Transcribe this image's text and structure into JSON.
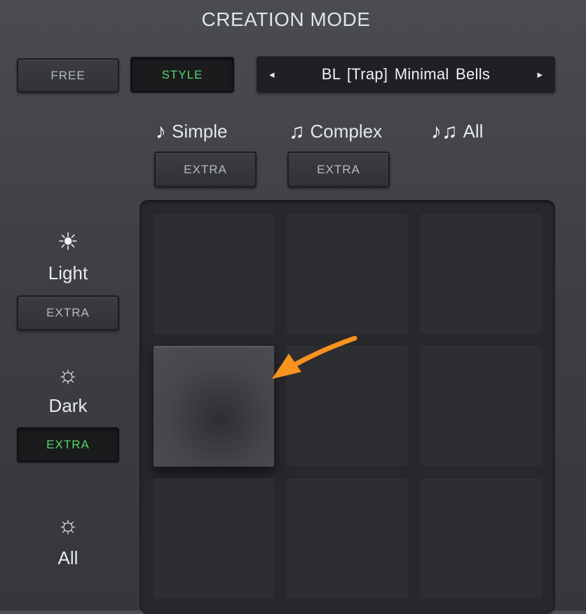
{
  "header": {
    "title": "CREATION MODE"
  },
  "mode_buttons": [
    {
      "label": "FREE",
      "active": false
    },
    {
      "label": "STYLE",
      "active": true
    }
  ],
  "preset": {
    "name": "BL  [Trap]  Minimal Bells",
    "prev_icon": "◂",
    "next_icon": "▸"
  },
  "complexity": [
    {
      "label": "Simple",
      "icon": "♪",
      "extra_label": "EXTRA",
      "extra_active": false
    },
    {
      "label": "Complex",
      "icon": "♫",
      "extra_label": "EXTRA",
      "extra_active": false
    },
    {
      "label": "All",
      "icon": "♪♫"
    }
  ],
  "brightness": [
    {
      "label": "Light",
      "icon": "☀",
      "extra_label": "EXTRA",
      "extra_active": false
    },
    {
      "label": "Dark",
      "icon": "☼",
      "extra_label": "EXTRA",
      "extra_active": true
    },
    {
      "label": "All",
      "icon": "☼"
    }
  ],
  "grid": {
    "rows": 3,
    "cols": 3,
    "selected_row": 2,
    "selected_col": 1
  },
  "colors": {
    "accent_green": "#56d66a",
    "annotation_arrow": "#f7931e"
  }
}
